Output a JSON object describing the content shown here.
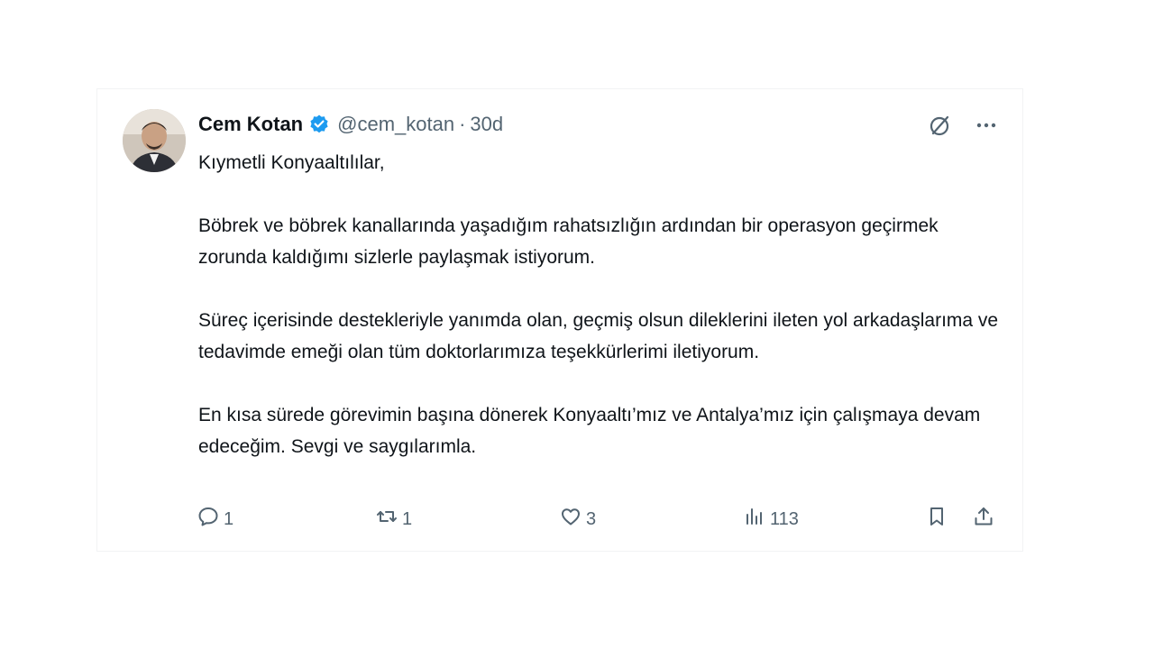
{
  "tweet": {
    "display_name": "Cem Kotan",
    "handle": "@cem_kotan",
    "separator": "·",
    "time": "30d",
    "paragraphs": [
      "Kıymetli Konyaaltılılar,",
      "Böbrek ve böbrek kanallarında yaşadığım rahatsızlığın ardından bir operasyon geçirmek zorunda kaldığımı sizlerle paylaşmak istiyorum.",
      "Süreç içerisinde destekleriyle yanımda olan, geçmiş olsun dileklerini ileten yol arkadaşlarıma ve tedavimde emeği olan tüm doktorlarımıza teşekkürlerimi iletiyorum.",
      "En kısa sürede görevimin başına dönerek Konyaaltı’mız ve Antalya’mız için çalışmaya devam edeceğim. Sevgi ve saygılarımla."
    ],
    "stats": {
      "replies": "1",
      "retweets": "1",
      "likes": "3",
      "views": "113"
    }
  },
  "icons": {
    "verified": "verified-badge-icon",
    "grok": "grok-icon",
    "more": "more-icon",
    "reply": "reply-icon",
    "retweet": "retweet-icon",
    "like": "heart-icon",
    "views": "views-chart-icon",
    "bookmark": "bookmark-icon",
    "share": "share-icon"
  },
  "colors": {
    "verified": "#1d9bf0",
    "secondary_text": "#536471",
    "primary_text": "#0f1419"
  }
}
